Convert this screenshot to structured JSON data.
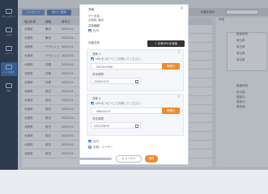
{
  "sidebar": {
    "items": [
      {
        "label": "ダッシュボード"
      },
      {
        "label": "マスタ"
      },
      {
        "label": "レポート"
      },
      {
        "label": "データ管理"
      },
      {
        "label": "設定"
      }
    ]
  },
  "toolbar": {
    "import_label": "インポート",
    "new_label": "新たに登録",
    "filter_label": "件数を表示"
  },
  "table": {
    "headers": [
      "最近処理",
      "種類",
      "基準日"
    ],
    "rows": [
      [
        "大阪府",
        "東京",
        "2025-01-"
      ],
      [
        "大阪府",
        "東京",
        "2025-01-"
      ],
      [
        "大阪府",
        "デラッシュ",
        "2025-01-"
      ],
      [
        "大阪府",
        "デラッシュ",
        "2025-01-"
      ],
      [
        "大阪府",
        "日帳",
        "2025-01-"
      ],
      [
        "大阪府",
        "日帳",
        "2025-01-"
      ],
      [
        "大阪府",
        "日帳",
        "2025-01-"
      ],
      [
        "大阪府",
        "前日",
        "2025-01-"
      ],
      [
        "大阪府",
        "前日",
        "2025-01-"
      ],
      [
        "大阪府",
        "前日",
        "2025-01-"
      ],
      [
        "大阪府",
        "前日",
        "2025-01-"
      ],
      [
        "大阪府",
        "前日",
        "2025-01-"
      ],
      [
        "大阪府",
        "前日",
        "2025-01-"
      ],
      [
        "大阪府",
        "前日",
        "2025-01-"
      ],
      [
        "大阪府",
        "前日",
        "2025-01-"
      ]
    ]
  },
  "right_panel": {
    "title": "詳細",
    "items": [
      "都道府県",
      "埼玉県",
      "埼玉県",
      "埼玉県",
      "埼玉県",
      "都道府県",
      "担当者：",
      "登録日：",
      "更新日：",
      "更新者："
    ]
  },
  "modal": {
    "title": "共有",
    "data_name_label": "データ名",
    "data_name_value": "大阪府_東京",
    "share_scope_label": "共有範囲",
    "share_scope_value": "社内",
    "external_label": "外部共有",
    "add_button": "+ 共有URLを追加",
    "shares": [
      {
        "num": "共有 1",
        "copy_label": "URLをコピーして共有してください",
        "url": "f3024d7f0f0",
        "reissue": "再発行",
        "expiry_label": "有効期限",
        "date": "2026/03/31"
      },
      {
        "num": "共有 2",
        "copy_label": "URLをコピーして共有してください",
        "url": "f9f8d3c1f7",
        "reissue": "再発行",
        "expiry_label": "有効期限",
        "date": "2025/06/30"
      }
    ],
    "option_internal": "社内",
    "option_all_users": "全員・ユーザー",
    "cancel": "キャンセル",
    "save": "保存"
  }
}
